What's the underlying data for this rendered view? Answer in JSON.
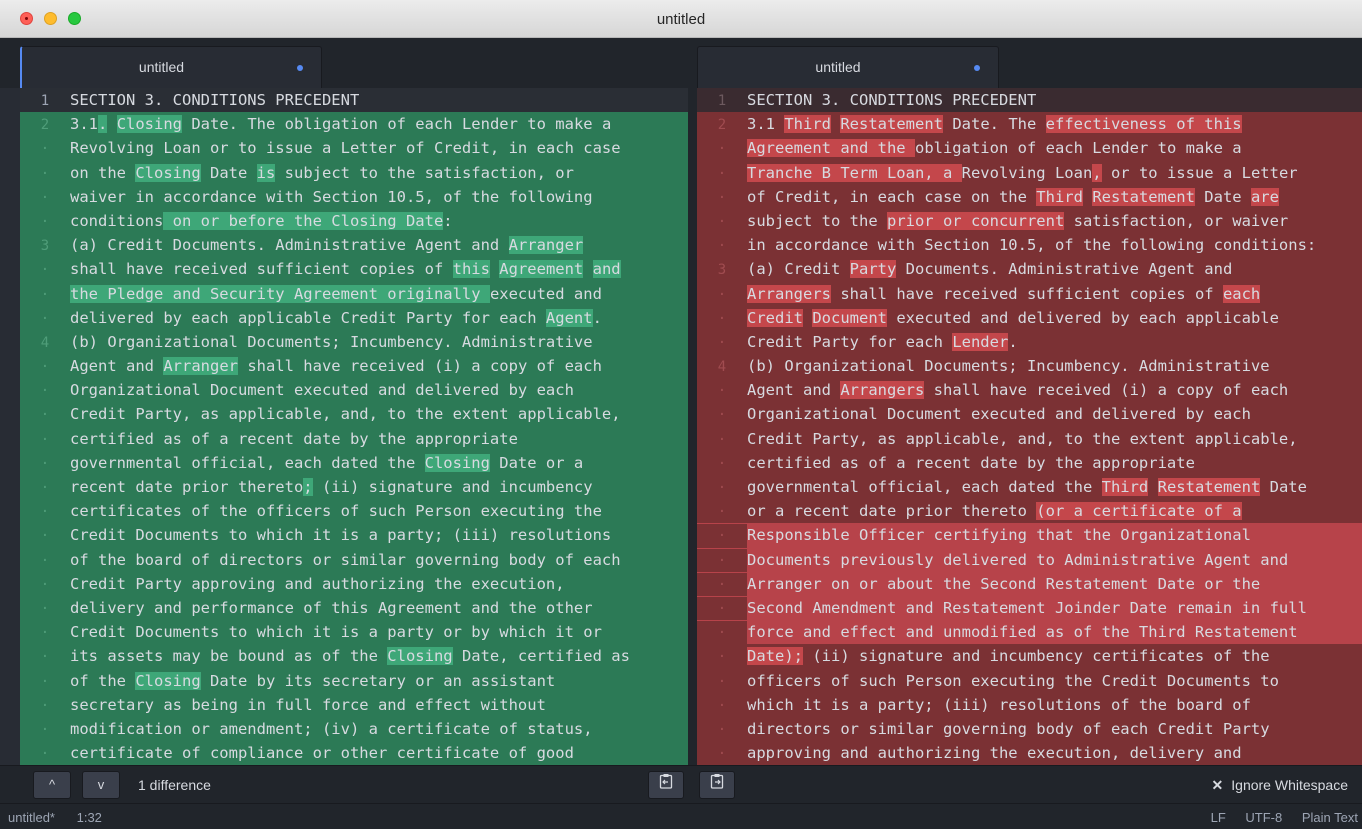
{
  "window": {
    "title": "untitled"
  },
  "tabs": [
    {
      "label": "untitled"
    },
    {
      "label": "untitled"
    }
  ],
  "left_lines": [
    {
      "n": "1",
      "segs": [
        [
          "SECTION 3. CONDITIONS PRECEDENT",
          0
        ]
      ]
    },
    {
      "n": "2",
      "segs": [
        [
          "3.1",
          0
        ],
        [
          ".",
          1
        ],
        [
          " ",
          0
        ],
        [
          "Closing",
          1
        ],
        [
          " Date. The obligation of each Lender to make a",
          0
        ]
      ]
    },
    {
      "n": "·",
      "segs": [
        [
          "Revolving Loan or to issue a Letter of Credit, in each case",
          0
        ]
      ]
    },
    {
      "n": "·",
      "segs": [
        [
          "on the ",
          0
        ],
        [
          "Closing",
          1
        ],
        [
          " Date ",
          0
        ],
        [
          "is",
          1
        ],
        [
          " subject to the satisfaction, or",
          0
        ]
      ]
    },
    {
      "n": "·",
      "segs": [
        [
          "waiver in accordance with Section 10.5, of the following",
          0
        ]
      ]
    },
    {
      "n": "·",
      "segs": [
        [
          "conditions",
          0
        ],
        [
          " on or before the Closing Date",
          1
        ],
        [
          ":",
          0
        ]
      ]
    },
    {
      "n": "3",
      "segs": [
        [
          "(a) Credit Documents. Administrative Agent and ",
          0
        ],
        [
          "Arranger",
          1
        ]
      ]
    },
    {
      "n": "·",
      "segs": [
        [
          "shall have received sufficient copies of ",
          0
        ],
        [
          "this",
          1
        ],
        [
          " ",
          0
        ],
        [
          "Agreement",
          1
        ],
        [
          " ",
          0
        ],
        [
          "and",
          1
        ]
      ]
    },
    {
      "n": "·",
      "segs": [
        [
          "the Pledge and Security Agreement originally ",
          1
        ],
        [
          "executed and",
          0
        ]
      ]
    },
    {
      "n": "·",
      "segs": [
        [
          "delivered by each applicable Credit Party for each ",
          0
        ],
        [
          "Agent",
          1
        ],
        [
          ".",
          0
        ]
      ]
    },
    {
      "n": "4",
      "segs": [
        [
          "(b) Organizational Documents; Incumbency. Administrative",
          0
        ]
      ]
    },
    {
      "n": "·",
      "segs": [
        [
          "Agent and ",
          0
        ],
        [
          "Arranger",
          1
        ],
        [
          " shall have received (i) a copy of each",
          0
        ]
      ]
    },
    {
      "n": "·",
      "segs": [
        [
          "Organizational Document executed and delivered by each",
          0
        ]
      ]
    },
    {
      "n": "·",
      "segs": [
        [
          "Credit Party, as applicable, and, to the extent applicable,",
          0
        ]
      ]
    },
    {
      "n": "·",
      "segs": [
        [
          "certified as of a recent date by the appropriate",
          0
        ]
      ]
    },
    {
      "n": "·",
      "segs": [
        [
          "governmental official, each dated the ",
          0
        ],
        [
          "Closing",
          1
        ],
        [
          " Date or a",
          0
        ]
      ]
    },
    {
      "n": "·",
      "segs": [
        [
          "recent date prior thereto",
          0
        ],
        [
          ";",
          1
        ],
        [
          " (ii) signature and incumbency",
          0
        ]
      ]
    },
    {
      "n": "·",
      "segs": [
        [
          "certificates of the officers of such Person executing the",
          0
        ]
      ]
    },
    {
      "n": "·",
      "segs": [
        [
          "Credit Documents to which it is a party; (iii) resolutions",
          0
        ]
      ]
    },
    {
      "n": "·",
      "segs": [
        [
          "of the board of directors or similar governing body of each",
          0
        ]
      ]
    },
    {
      "n": "·",
      "segs": [
        [
          "Credit Party approving and authorizing the execution,",
          0
        ]
      ]
    },
    {
      "n": "·",
      "segs": [
        [
          "delivery and performance of this Agreement and the other",
          0
        ]
      ]
    },
    {
      "n": "·",
      "segs": [
        [
          "Credit Documents to which it is a party or by which it or",
          0
        ]
      ]
    },
    {
      "n": "·",
      "segs": [
        [
          "its assets may be bound as of the ",
          0
        ],
        [
          "Closing",
          1
        ],
        [
          " Date, certified as",
          0
        ]
      ]
    },
    {
      "n": "·",
      "segs": [
        [
          "of the ",
          0
        ],
        [
          "Closing",
          1
        ],
        [
          " Date by its secretary or an assistant",
          0
        ]
      ]
    },
    {
      "n": "·",
      "segs": [
        [
          "secretary as being in full force and effect without",
          0
        ]
      ]
    },
    {
      "n": "·",
      "segs": [
        [
          "modification or amendment; (iv) a certificate of status,",
          0
        ]
      ]
    },
    {
      "n": "·",
      "segs": [
        [
          "certificate of compliance or other certificate of good",
          0
        ]
      ]
    }
  ],
  "right_lines": [
    {
      "n": "1",
      "segs": [
        [
          "SECTION 3. CONDITIONS PRECEDENT",
          0
        ]
      ]
    },
    {
      "n": "2",
      "segs": [
        [
          "3.1 ",
          0
        ],
        [
          "Third",
          1
        ],
        [
          " ",
          0
        ],
        [
          "Restatement",
          1
        ],
        [
          " Date. The ",
          0
        ],
        [
          "effectiveness of this",
          1
        ]
      ]
    },
    {
      "n": "·",
      "segs": [
        [
          "Agreement and the ",
          1
        ],
        [
          "obligation of each Lender to make a",
          0
        ]
      ]
    },
    {
      "n": "·",
      "segs": [
        [
          "Tranche B Term Loan, a ",
          1
        ],
        [
          "Revolving Loan",
          0
        ],
        [
          ",",
          1
        ],
        [
          " or to issue a Letter",
          0
        ]
      ]
    },
    {
      "n": "·",
      "segs": [
        [
          "of Credit, in each case on the ",
          0
        ],
        [
          "Third",
          1
        ],
        [
          " ",
          0
        ],
        [
          "Restatement",
          1
        ],
        [
          " Date ",
          0
        ],
        [
          "are",
          1
        ]
      ]
    },
    {
      "n": "·",
      "segs": [
        [
          "subject to the ",
          0
        ],
        [
          "prior or concurrent",
          1
        ],
        [
          " satisfaction, or waiver",
          0
        ]
      ]
    },
    {
      "n": "·",
      "segs": [
        [
          "in accordance with Section 10.5, of the following conditions:",
          0
        ]
      ]
    },
    {
      "n": "3",
      "segs": [
        [
          "(a) Credit ",
          0
        ],
        [
          "Party",
          1
        ],
        [
          " Documents. Administrative Agent and",
          0
        ]
      ]
    },
    {
      "n": "·",
      "segs": [
        [
          "Arrangers",
          1
        ],
        [
          " shall have received sufficient copies of ",
          0
        ],
        [
          "each",
          1
        ]
      ]
    },
    {
      "n": "·",
      "segs": [
        [
          "Credit",
          1
        ],
        [
          " ",
          0
        ],
        [
          "Document",
          1
        ],
        [
          " executed and delivered by each applicable",
          0
        ]
      ]
    },
    {
      "n": "·",
      "segs": [
        [
          "Credit Party for each ",
          0
        ],
        [
          "Lender",
          1
        ],
        [
          ".",
          0
        ]
      ]
    },
    {
      "n": "4",
      "segs": [
        [
          "(b) Organizational Documents; Incumbency. Administrative",
          0
        ]
      ]
    },
    {
      "n": "·",
      "segs": [
        [
          "Agent and ",
          0
        ],
        [
          "Arrangers",
          1
        ],
        [
          " shall have received (i) a copy of each",
          0
        ]
      ]
    },
    {
      "n": "·",
      "segs": [
        [
          "Organizational Document executed and delivered by each",
          0
        ]
      ]
    },
    {
      "n": "·",
      "segs": [
        [
          "Credit Party, as applicable, and, to the extent applicable,",
          0
        ]
      ]
    },
    {
      "n": "·",
      "segs": [
        [
          "certified as of a recent date by the appropriate",
          0
        ]
      ]
    },
    {
      "n": "·",
      "segs": [
        [
          "governmental official, each dated the ",
          0
        ],
        [
          "Third",
          1
        ],
        [
          " ",
          0
        ],
        [
          "Restatement",
          1
        ],
        [
          " Date",
          0
        ]
      ]
    },
    {
      "n": "·",
      "segs": [
        [
          "or a recent date prior thereto ",
          0
        ],
        [
          "(or a certificate of a",
          1
        ]
      ]
    },
    {
      "n": "·",
      "full": true,
      "segs": [
        [
          "Responsible Officer certifying that the Organizational",
          0
        ]
      ]
    },
    {
      "n": "·",
      "full": true,
      "segs": [
        [
          "Documents previously delivered to Administrative Agent and",
          0
        ]
      ]
    },
    {
      "n": "·",
      "full": true,
      "segs": [
        [
          "Arranger on or about the Second Restatement Date or the",
          0
        ]
      ]
    },
    {
      "n": "·",
      "full": true,
      "segs": [
        [
          "Second Amendment and Restatement Joinder Date remain in full",
          0
        ]
      ]
    },
    {
      "n": "·",
      "full": true,
      "segs": [
        [
          "force and effect and unmodified as of the Third Restatement",
          0
        ]
      ]
    },
    {
      "n": "·",
      "segs": [
        [
          "Date);",
          1
        ],
        [
          " (ii) signature and incumbency certificates of the",
          0
        ]
      ]
    },
    {
      "n": "·",
      "segs": [
        [
          "officers of such Person executing the Credit Documents to",
          0
        ]
      ]
    },
    {
      "n": "·",
      "segs": [
        [
          "which it is a party; (iii) resolutions of the board of",
          0
        ]
      ]
    },
    {
      "n": "·",
      "segs": [
        [
          "directors or similar governing body of each Credit Party",
          0
        ]
      ]
    },
    {
      "n": "·",
      "segs": [
        [
          "approving and authorizing the execution, delivery and",
          0
        ]
      ]
    }
  ],
  "bottombar": {
    "prev_icon": "^",
    "next_icon": "v",
    "diff_count": "1 difference",
    "ignore_x": "✕",
    "ignore_label": "Ignore Whitespace"
  },
  "status": {
    "file": "untitled*",
    "cursor": "1:32",
    "line_ending": "LF",
    "encoding": "UTF-8",
    "grammar": "Plain Text"
  },
  "colors": {
    "added_bg": "#2c7a56",
    "added_hl": "#3ea778",
    "removed_bg": "#7b3134",
    "removed_hl": "#c4474b",
    "accent": "#568af2"
  }
}
